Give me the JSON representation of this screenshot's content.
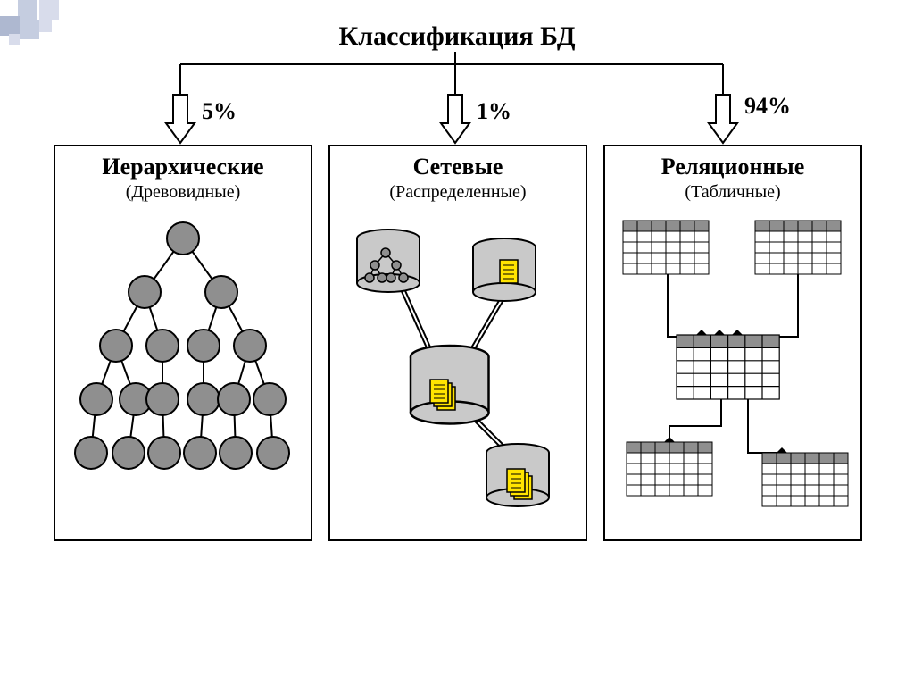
{
  "title": "Классификация БД",
  "branches": [
    {
      "percent": "5%",
      "name": "Иерархические",
      "subtitle": "(Древовидные)"
    },
    {
      "percent": "1%",
      "name": "Сетевые",
      "subtitle": "(Распределенные)"
    },
    {
      "percent": "94%",
      "name": "Реляционные",
      "subtitle": "(Табличные)"
    }
  ],
  "chart_data": {
    "type": "bar",
    "title": "Классификация БД",
    "categories": [
      "Иерархические",
      "Сетевые",
      "Реляционные"
    ],
    "values": [
      5,
      1,
      94
    ],
    "ylabel": "%",
    "ylim": [
      0,
      100
    ]
  }
}
